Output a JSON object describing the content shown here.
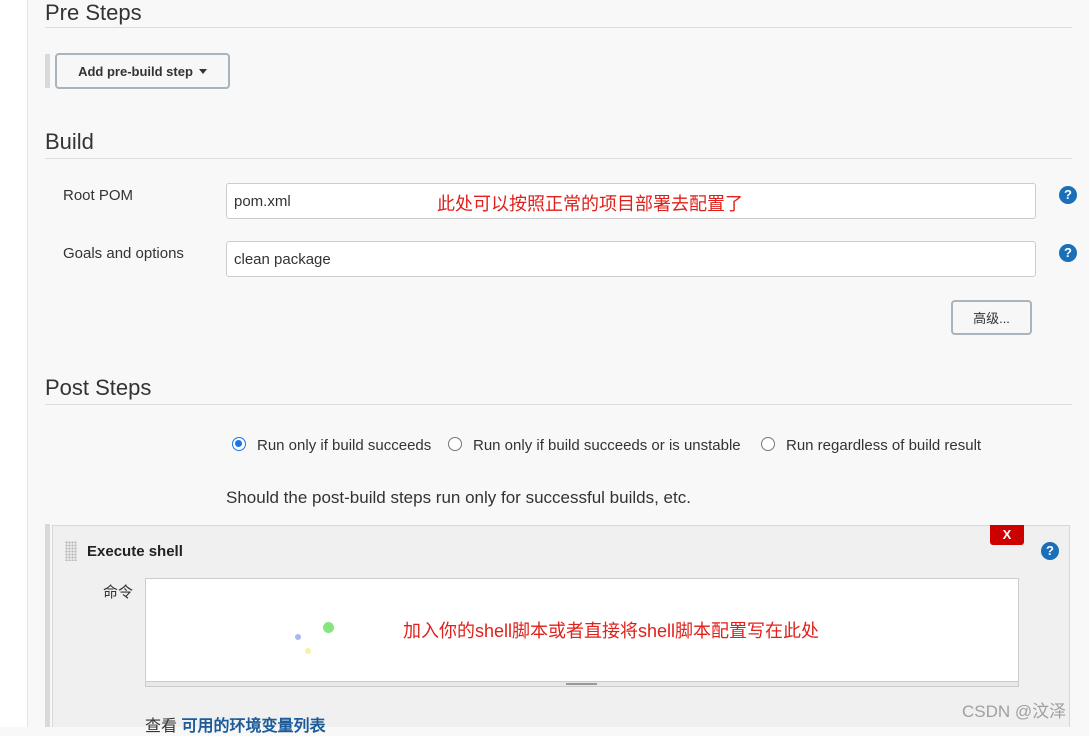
{
  "pre_steps": {
    "title": "Pre Steps",
    "add_button_label": "Add pre-build step"
  },
  "build": {
    "title": "Build",
    "root_pom_label": "Root POM",
    "root_pom_value": "pom.xml",
    "goals_label": "Goals and options",
    "goals_value": "clean package",
    "advanced_label": "高级...",
    "annotation": "此处可以按照正常的项目部署去配置了"
  },
  "post_steps": {
    "title": "Post Steps",
    "options": [
      {
        "label": "Run only if build succeeds",
        "selected": true
      },
      {
        "label": "Run only if build succeeds or is unstable",
        "selected": false
      },
      {
        "label": "Run regardless of build result",
        "selected": false
      }
    ],
    "description": "Should the post-build steps run only for successful builds, etc."
  },
  "execute_shell": {
    "title": "Execute shell",
    "delete_label": "X",
    "command_label": "命令",
    "annotation": "加入你的shell脚本或者直接将shell脚本配置写在此处",
    "env_prefix": "查看",
    "env_link": "可用的环境变量列表"
  },
  "help_icon_glyph": "?",
  "watermark": "CSDN @汶泽",
  "colors": {
    "accent": "#1b6eb8",
    "annotation": "#e0201b",
    "delete": "#cc0000",
    "link": "#1b5b9a"
  }
}
